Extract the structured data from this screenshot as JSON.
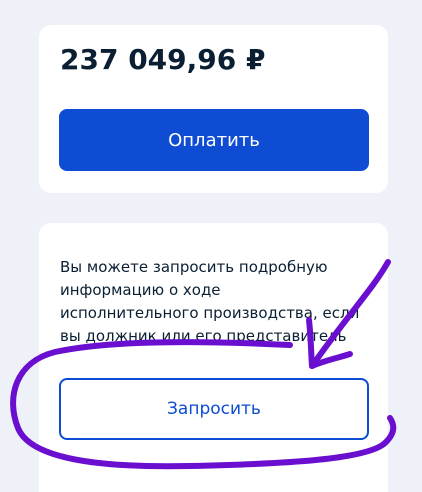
{
  "payment": {
    "amount": "237 049,96 ₽",
    "pay_button_label": "Оплатить"
  },
  "request": {
    "info_text": "Вы можете запросить подробную информацию о ходе исполнительного производства, если вы должник или его представитель",
    "request_button_label": "Запросить"
  },
  "colors": {
    "background": "#eef2f8",
    "card": "#ffffff",
    "primary": "#0d4cd3",
    "text": "#0b1f33",
    "annotation": "#6a0fd0"
  }
}
